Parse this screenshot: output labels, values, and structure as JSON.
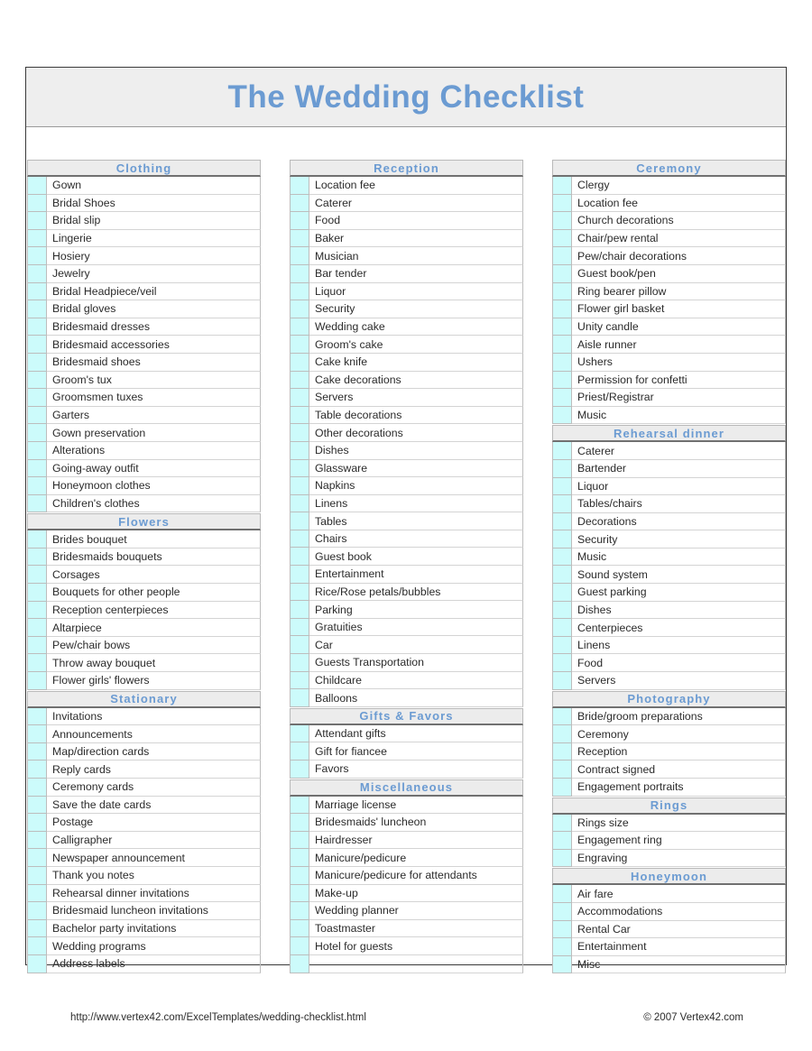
{
  "document": {
    "title": "The Wedding Checklist",
    "accent_color": "#6b9bd2",
    "checkbox_color": "#ccfbfb",
    "header_bg": "#ececec"
  },
  "footer": {
    "url": "http://www.vertex42.com/ExcelTemplates/wedding-checklist.html",
    "copyright": "© 2007 Vertex42.com"
  },
  "columns": [
    {
      "name": "column-left",
      "sections": [
        {
          "title": "Clothing",
          "items": [
            "Gown",
            "Bridal Shoes",
            "Bridal slip",
            "Lingerie",
            "Hosiery",
            "Jewelry",
            "Bridal Headpiece/veil",
            "Bridal gloves",
            "Bridesmaid dresses",
            "Bridesmaid accessories",
            "Bridesmaid shoes",
            "Groom's tux",
            "Groomsmen tuxes",
            "Garters",
            "Gown preservation",
            "Alterations",
            "Going-away outfit",
            "Honeymoon clothes",
            "Children's clothes"
          ]
        },
        {
          "title": "Flowers",
          "items": [
            "Brides bouquet",
            "Bridesmaids bouquets",
            "Corsages",
            "Bouquets for other people",
            "Reception centerpieces",
            "Altarpiece",
            "Pew/chair bows",
            "Throw away bouquet",
            "Flower girls' flowers"
          ]
        },
        {
          "title": "Stationary",
          "items": [
            "Invitations",
            "Announcements",
            "Map/direction cards",
            "Reply cards",
            "Ceremony cards",
            "Save the date cards",
            "Postage",
            "Calligrapher",
            "Newspaper announcement",
            "Thank you notes",
            "Rehearsal dinner invitations",
            "Bridesmaid luncheon invitations",
            "Bachelor party invitations",
            "Wedding programs",
            "Address labels"
          ]
        }
      ]
    },
    {
      "name": "column-middle",
      "sections": [
        {
          "title": "Reception",
          "items": [
            "Location fee",
            "Caterer",
            "Food",
            "Baker",
            "Musician",
            "Bar tender",
            "Liquor",
            "Security",
            "Wedding cake",
            "Groom's cake",
            "Cake knife",
            "Cake decorations",
            "Servers",
            "Table decorations",
            "Other decorations",
            "Dishes",
            "Glassware",
            "Napkins",
            "Linens",
            "Tables",
            "Chairs",
            "Guest book",
            "Entertainment",
            "Rice/Rose petals/bubbles",
            "Parking",
            "Gratuities",
            "Car",
            "Guests Transportation",
            "Childcare",
            "Balloons"
          ]
        },
        {
          "title": "Gifts & Favors",
          "items": [
            "Attendant gifts",
            "Gift for fiancee",
            "Favors"
          ]
        },
        {
          "title": "Miscellaneous",
          "items": [
            "Marriage license",
            "Bridesmaids' luncheon",
            "Hairdresser",
            "Manicure/pedicure",
            "Manicure/pedicure for attendants",
            "Make-up",
            "Wedding planner",
            "Toastmaster",
            "Hotel for guests",
            ""
          ]
        }
      ]
    },
    {
      "name": "column-right",
      "sections": [
        {
          "title": "Ceremony",
          "items": [
            "Clergy",
            "Location fee",
            "Church decorations",
            "Chair/pew rental",
            "Pew/chair decorations",
            "Guest book/pen",
            "Ring bearer pillow",
            "Flower girl basket",
            "Unity candle",
            "Aisle runner",
            "Ushers",
            "Permission for confetti",
            "Priest/Registrar",
            "Music"
          ]
        },
        {
          "title": "Rehearsal dinner",
          "items": [
            "Caterer",
            "Bartender",
            "Liquor",
            "Tables/chairs",
            "Decorations",
            "Security",
            "Music",
            "Sound system",
            "Guest parking",
            "Dishes",
            "Centerpieces",
            "Linens",
            "Food",
            "Servers"
          ]
        },
        {
          "title": "Photography",
          "items": [
            "Bride/groom preparations",
            "Ceremony",
            "Reception",
            "Contract signed",
            "Engagement portraits"
          ]
        },
        {
          "title": "Rings",
          "items": [
            "Rings size",
            "Engagement ring",
            "Engraving"
          ]
        },
        {
          "title": "Honeymoon",
          "items": [
            "Air fare",
            "Accommodations",
            "Rental Car",
            "Entertainment",
            "Misc"
          ]
        }
      ]
    }
  ]
}
